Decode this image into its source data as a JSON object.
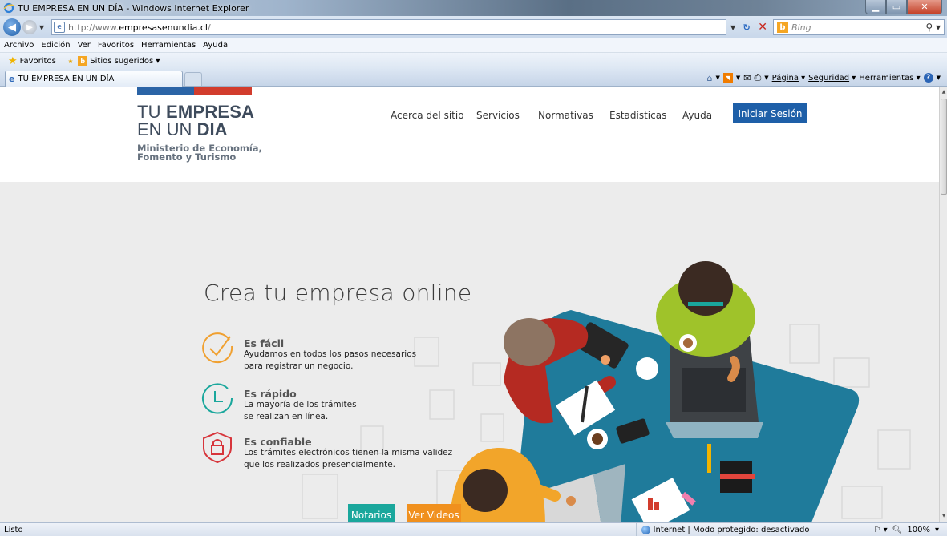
{
  "window": {
    "title": "TU EMPRESA EN UN DÍA - Windows Internet Explorer"
  },
  "address_bar": {
    "url_prefix": "http://www.",
    "url_domain": "empresasenundia.cl",
    "url_suffix": "/",
    "search_placeholder": "Bing"
  },
  "menu": [
    "Archivo",
    "Edición",
    "Ver",
    "Favoritos",
    "Herramientas",
    "Ayuda"
  ],
  "favorites_bar": {
    "favorites_label": "Favoritos",
    "suggested_label": "Sitios sugeridos ▾"
  },
  "tab": {
    "title": "TU EMPRESA EN UN DÍA"
  },
  "command_bar": {
    "page": "Página",
    "security": "Seguridad",
    "tools": "Herramientas"
  },
  "site": {
    "logo_line1_light": "TU ",
    "logo_line1_bold": "EMPRESA",
    "logo_line2_light": "EN UN ",
    "logo_line2_bold": "DIA",
    "ministry_line1": "Ministerio de Economía,",
    "ministry_line2": "Fomento y Turismo",
    "nav": [
      "Acerca del sitio",
      "Servicios",
      "Normativas",
      "Estadísticas",
      "Ayuda"
    ],
    "login": "Iniciar Sesión",
    "brand_blue": "#1e5fa8",
    "brand_red": "#d23c2d"
  },
  "hero": {
    "title": "Crea tu empresa online",
    "features": [
      {
        "icon": "check-circle-icon",
        "title": "Es fácil",
        "line1": "Ayudamos en todos los pasos necesarios",
        "line2": "para registrar un negocio.",
        "color": "#f0a030"
      },
      {
        "icon": "clock-circle-icon",
        "title": "Es rápido",
        "line1": "La mayoría de los trámites",
        "line2": "se realizan en línea.",
        "color": "#1aa79c"
      },
      {
        "icon": "lock-shield-icon",
        "title": "Es confiable",
        "line1": "Los trámites electrónicos tienen la misma validez",
        "line2": "que los realizados presencialmente.",
        "color": "#d7353b"
      }
    ],
    "buttons": {
      "notarios": "Notarios",
      "videos": "Ver Videos"
    }
  },
  "status_bar": {
    "left": "Listo",
    "zone": "Internet | Modo protegido: desactivado",
    "zoom": "100%"
  }
}
